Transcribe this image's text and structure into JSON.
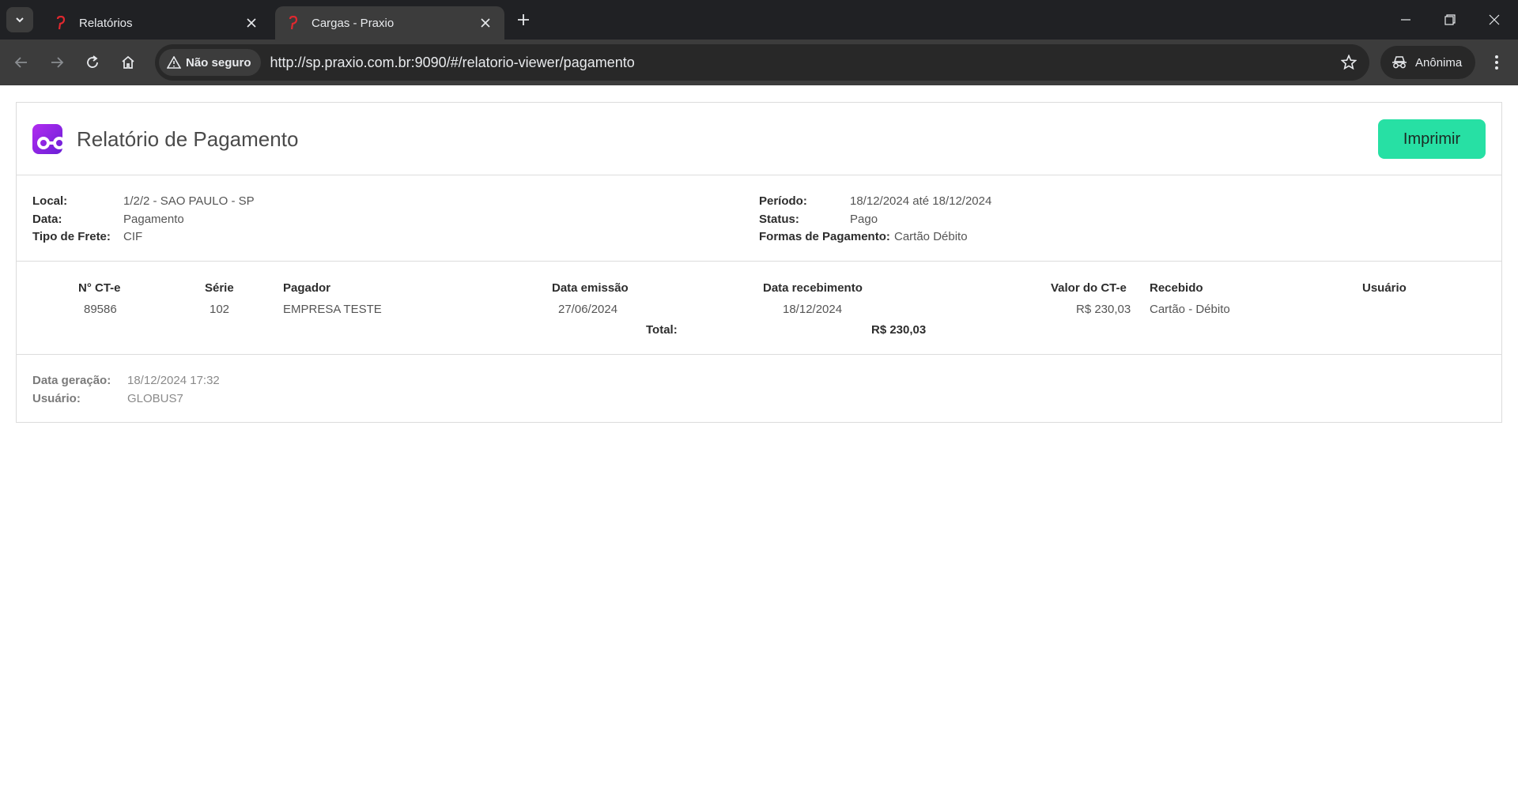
{
  "browser": {
    "tabs": [
      {
        "title": "Relatórios",
        "favicon": "praxio-p-icon"
      },
      {
        "title": "Cargas - Praxio",
        "favicon": "praxio-p-icon"
      }
    ],
    "security_label": "Não seguro",
    "url": "http://sp.praxio.com.br:9090/#/relatorio-viewer/pagamento",
    "profile_label": "Anônima",
    "colors": {
      "tabstrip": "#202124",
      "toolbar": "#3c3c3c",
      "favicon": "#e0282f"
    }
  },
  "report": {
    "title": "Relatório de Pagamento",
    "print_label": "Imprimir",
    "accent": "#27e0a4",
    "filters": {
      "local_label": "Local:",
      "local_value": "1/2/2 - SAO PAULO - SP",
      "data_label": "Data:",
      "data_value": "Pagamento",
      "frete_label": "Tipo de Frete:",
      "frete_value": "CIF",
      "periodo_label": "Período:",
      "periodo_value": "18/12/2024 até 18/12/2024",
      "status_label": "Status:",
      "status_value": "Pago",
      "formas_label": "Formas de Pagamento:",
      "formas_value": "Cartão Débito"
    },
    "table": {
      "headers": [
        "N° CT-e",
        "Série",
        "Pagador",
        "Data emissão",
        "Data recebimento",
        "Valor do CT-e",
        "Recebido",
        "Usuário"
      ],
      "rows": [
        {
          "ncte": "89586",
          "serie": "102",
          "pagador": "EMPRESA TESTE",
          "emissao": "27/06/2024",
          "recebimento": "18/12/2024",
          "valor": "R$ 230,03",
          "recebido": "Cartão - Débito",
          "usuario": ""
        }
      ],
      "total_label": "Total:",
      "total_value": "R$ 230,03"
    },
    "footer": {
      "geracao_label": "Data geração:",
      "geracao_value": "18/12/2024 17:32",
      "usuario_label": "Usuário:",
      "usuario_value": "GLOBUS7"
    }
  }
}
